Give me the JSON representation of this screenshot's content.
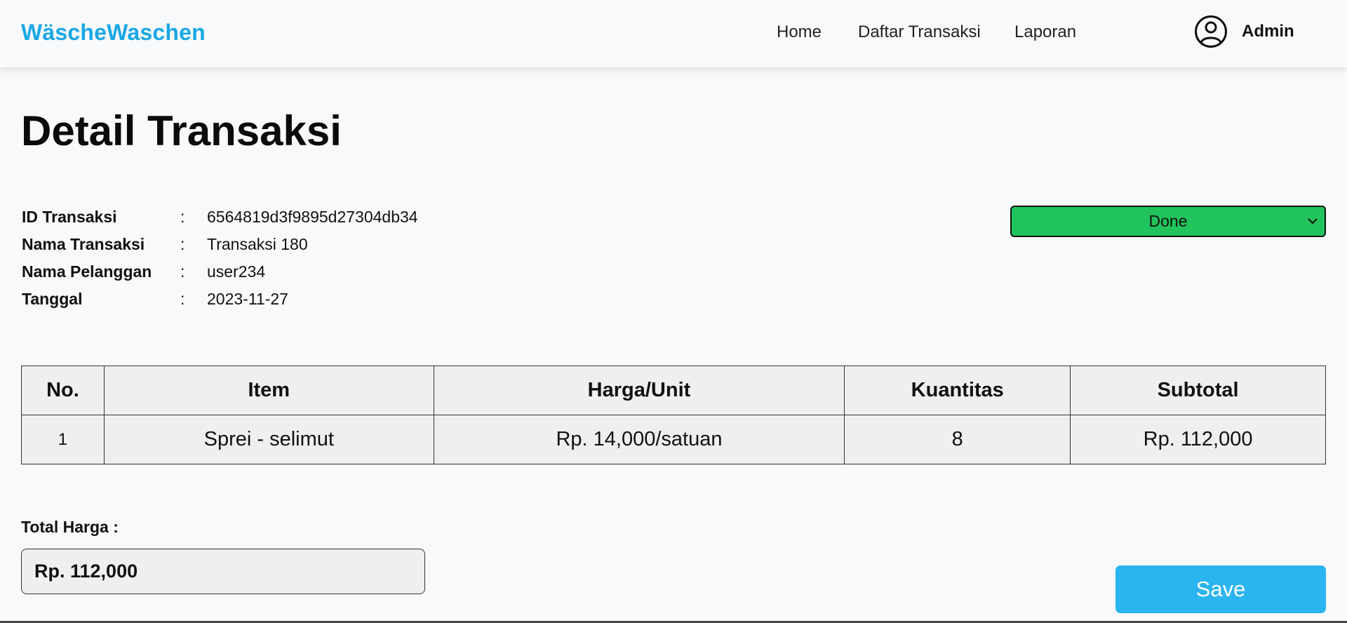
{
  "brand": "WäscheWaschen",
  "nav": {
    "links": [
      {
        "label": "Home"
      },
      {
        "label": "Daftar Transaksi"
      },
      {
        "label": "Laporan"
      }
    ],
    "user": {
      "name": "Admin",
      "icon": "user-circle-icon"
    }
  },
  "page": {
    "title": "Detail Transaksi"
  },
  "transaction": {
    "fields": [
      {
        "label": "ID Transaksi",
        "value": "6564819d3f9895d27304db34"
      },
      {
        "label": "Nama Transaksi",
        "value": "Transaksi 180"
      },
      {
        "label": "Nama Pelanggan",
        "value": "user234"
      },
      {
        "label": "Tanggal",
        "value": "2023-11-27"
      }
    ],
    "separator": ":"
  },
  "status": {
    "selected": "Done",
    "color": "#21c45c",
    "icon": "chevron-down-icon"
  },
  "table": {
    "headers": [
      "No.",
      "Item",
      "Harga/Unit",
      "Kuantitas",
      "Subtotal"
    ],
    "rows": [
      [
        "1",
        "Sprei - selimut",
        "Rp. 14,000/satuan",
        "8",
        "Rp. 112,000"
      ]
    ]
  },
  "total": {
    "label": "Total Harga :",
    "value": "Rp. 112,000"
  },
  "actions": {
    "save_label": "Save",
    "save_color": "#2ab4f0"
  },
  "colors": {
    "brand": "#1aa7e5",
    "background": "#f8f9fb"
  }
}
